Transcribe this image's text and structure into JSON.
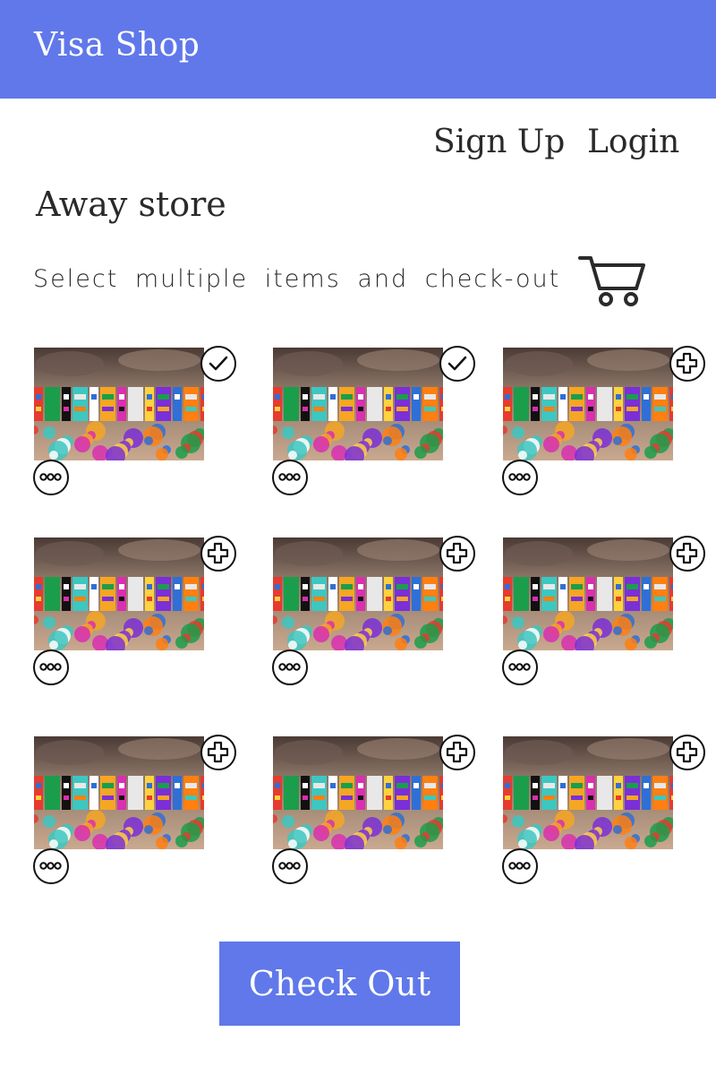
{
  "header": {
    "brand": "Visa Shop"
  },
  "auth": {
    "signup_label": "Sign Up",
    "login_label": "Login"
  },
  "store": {
    "title": "Away store",
    "subtitle": "Select multiple items and check-out",
    "cart_icon": "cart-icon"
  },
  "items": [
    {
      "selected": true
    },
    {
      "selected": true
    },
    {
      "selected": false
    },
    {
      "selected": false
    },
    {
      "selected": false
    },
    {
      "selected": false
    },
    {
      "selected": false
    },
    {
      "selected": false
    },
    {
      "selected": false
    }
  ],
  "icons": {
    "selected": "check-icon",
    "unselected": "plus-icon",
    "more": "more-icon"
  },
  "checkout": {
    "label": "Check Out"
  },
  "colors": {
    "accent": "#6078ea",
    "text": "#2a2a2a"
  }
}
